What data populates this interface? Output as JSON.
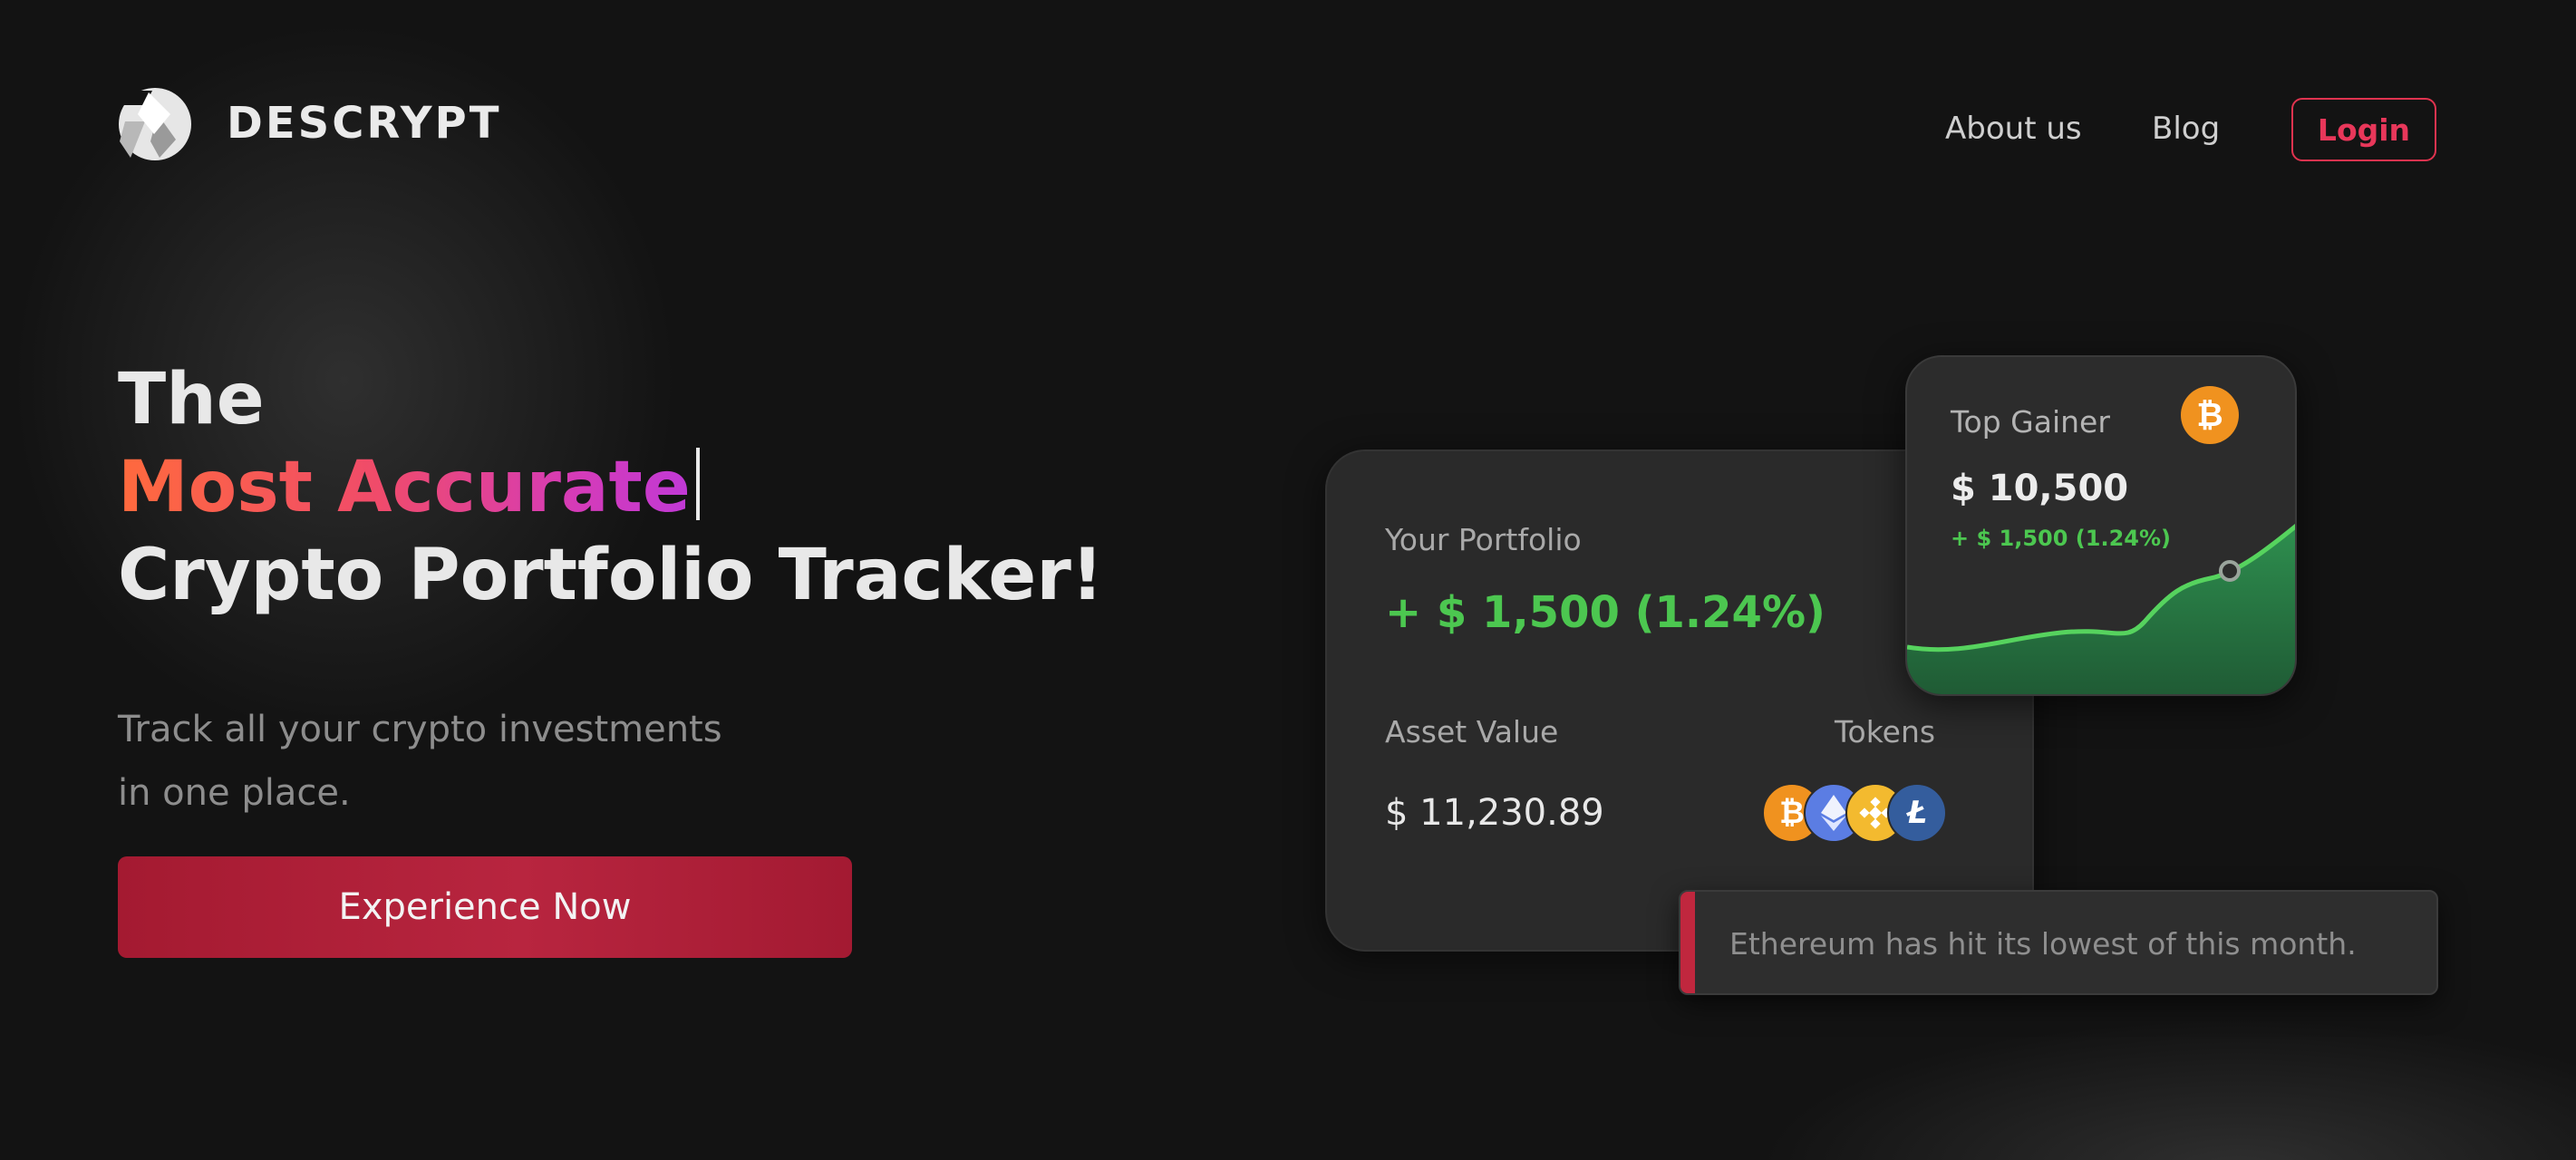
{
  "nav": {
    "brand": "DESCRYPT",
    "links": [
      "About us",
      "Blog"
    ],
    "login": "Login"
  },
  "hero": {
    "line1": "The",
    "line2": "Most Accurate",
    "line3": "Crypto Portfolio Tracker!",
    "subtitle_1": "Track all your crypto investments",
    "subtitle_2": "in one place.",
    "cta": "Experience Now"
  },
  "portfolio": {
    "title": "Your Portfolio",
    "change": "+ $ 1,500 (1.24%)",
    "asset_label": "Asset Value",
    "asset_value": "$ 11,230.89",
    "tokens_label": "Tokens",
    "tokens": [
      "bitcoin-icon",
      "ethereum-icon",
      "binance-icon",
      "litecoin-icon"
    ]
  },
  "top_gainer": {
    "title": "Top Gainer",
    "value": "$ 10,500",
    "change": "+ $ 1,500 (1.24%)",
    "icon": "bitcoin-icon"
  },
  "notification": {
    "text": "Ethereum has hit its lowest of this month."
  },
  "colors": {
    "accent": "#e0334f",
    "cta": "#a41a31",
    "positive": "#4cc750",
    "background": "#131313"
  }
}
